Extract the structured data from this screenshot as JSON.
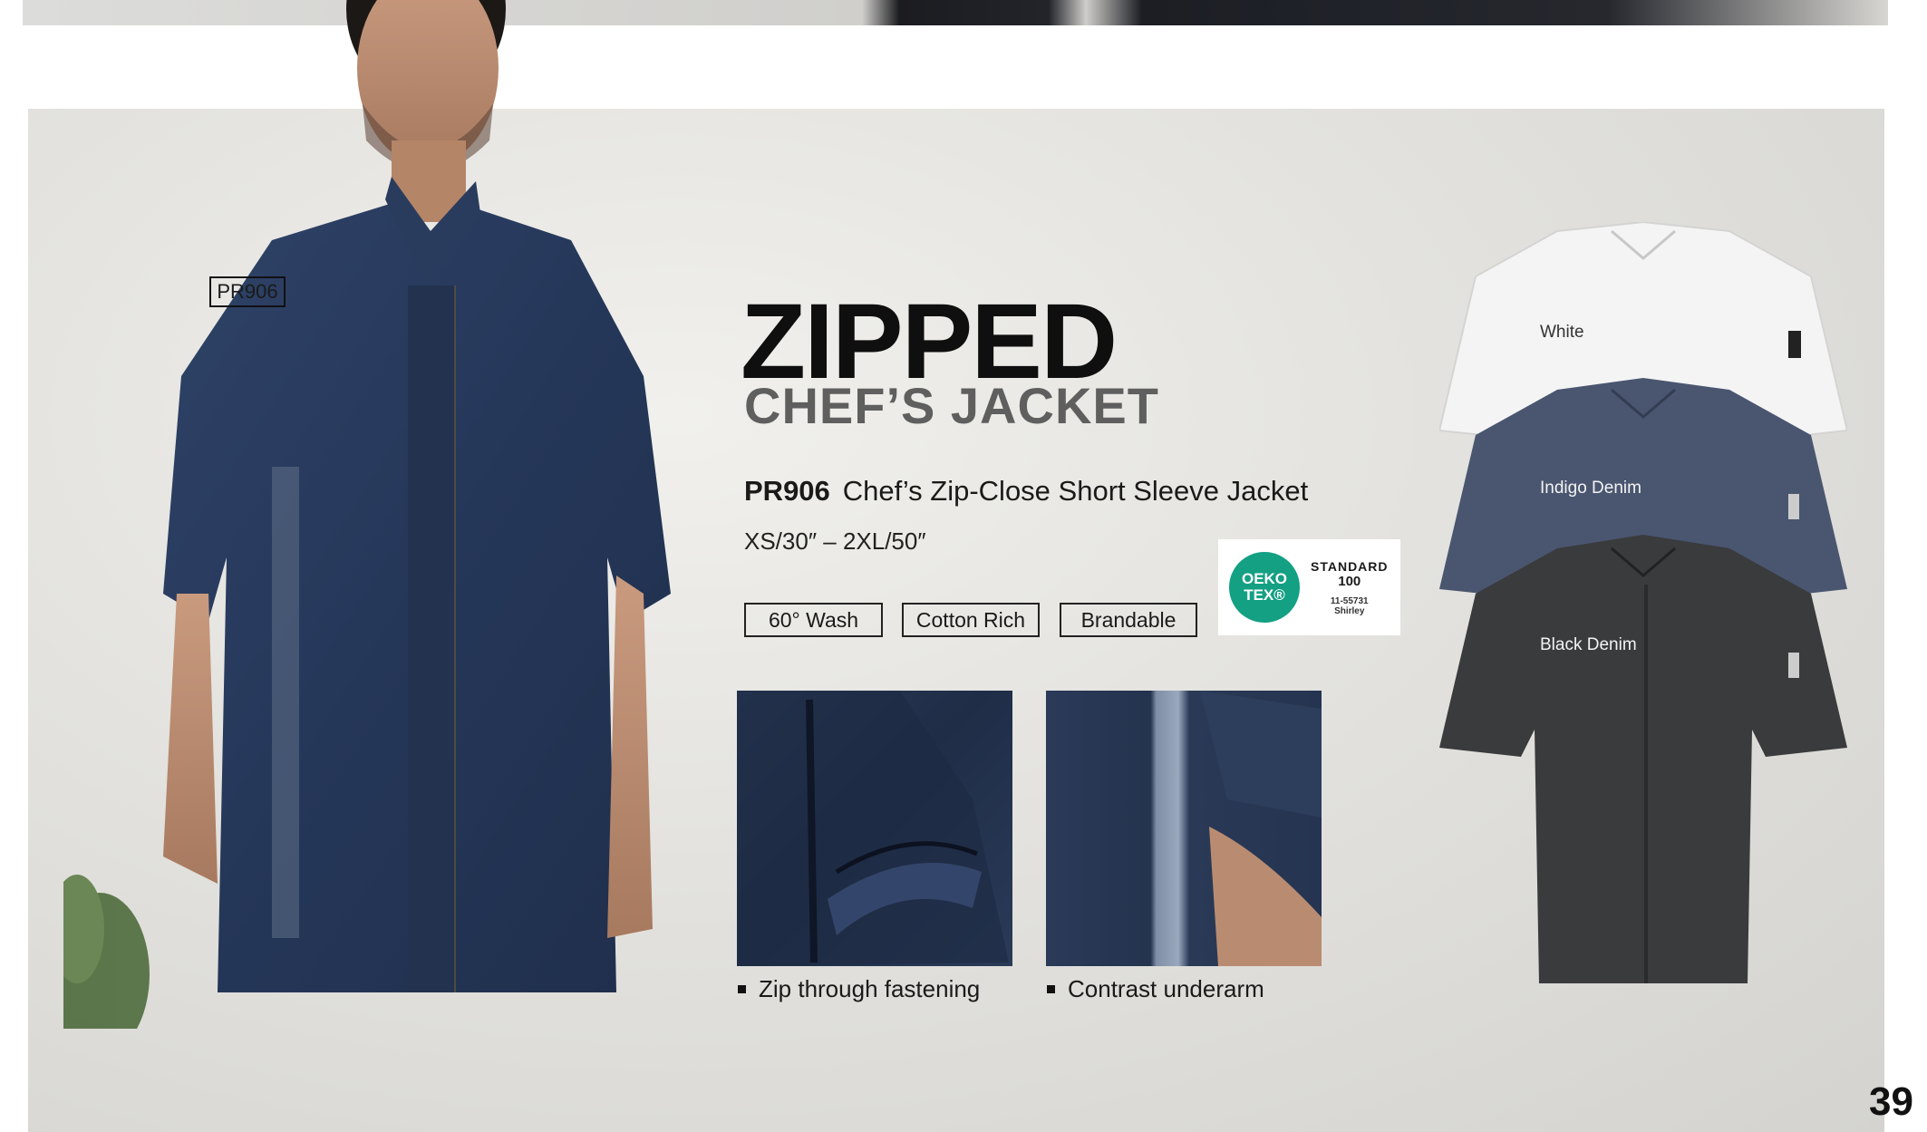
{
  "product_tag": "PR906",
  "headline": {
    "main": "ZIPPED",
    "sub": "CHEF’S JACKET"
  },
  "product": {
    "code": "PR906",
    "name": "Chef’s  Zip-Close Short Sleeve Jacket",
    "sizes": "XS/30″ – 2XL/50″"
  },
  "badges": [
    "60° Wash",
    "Cotton Rich",
    "Brandable"
  ],
  "certification": {
    "logo_line1": "OEKO",
    "logo_line2": "TEX®",
    "standard": "STANDARD",
    "number": "100",
    "cert_id": "11-55731",
    "issuer": "Shirley",
    "logo_color": "#13a083"
  },
  "features": [
    "Zip through fastening",
    "Contrast underarm"
  ],
  "colors": [
    {
      "name": "White",
      "hex": "#f4f4f4"
    },
    {
      "name": "Indigo Denim",
      "hex": "#4a5670"
    },
    {
      "name": "Black Denim",
      "hex": "#3a3b3d"
    }
  ],
  "page_number": "39"
}
